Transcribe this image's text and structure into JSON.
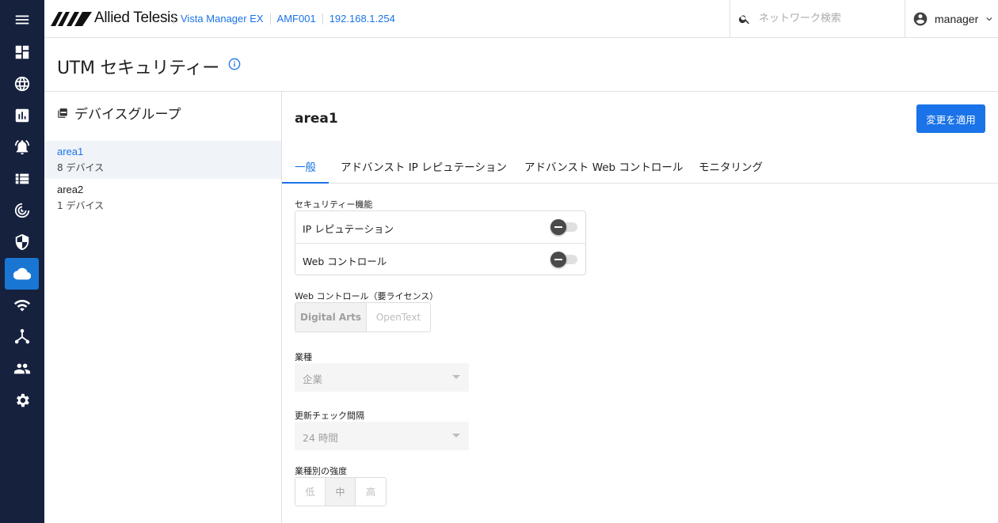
{
  "brand": {
    "logo_text": "Allied Telesis"
  },
  "breadcrumbs": [
    "Vista Manager EX",
    "AMF001",
    "192.168.1.254"
  ],
  "search": {
    "placeholder": "ネットワーク検索"
  },
  "user": {
    "name": "manager"
  },
  "page": {
    "title": "UTM セキュリティー"
  },
  "groups": {
    "heading": "デバイスグループ",
    "items": [
      {
        "name": "area1",
        "count": "8 デバイス"
      },
      {
        "name": "area2",
        "count": "1 デバイス"
      }
    ]
  },
  "detail": {
    "title": "area1",
    "apply_label": "変更を適用",
    "tabs": [
      "一般",
      "アドバンスト IP レピュテーション",
      "アドバンスト Web コントロール",
      "モニタリング"
    ],
    "features_label": "セキュリティー機能",
    "features": [
      {
        "label": "IP レピュテーション",
        "enabled": false
      },
      {
        "label": "Web コントロール",
        "enabled": false
      }
    ],
    "web_control_label": "Web コントロール（要ライセンス）",
    "web_control_options": [
      "Digital Arts",
      "OpenText"
    ],
    "web_control_selected": "Digital Arts",
    "industry_label": "業種",
    "industry_value": "企業",
    "interval_label": "更新チェック間隔",
    "interval_value": "24 時間",
    "strength_label": "業種別の強度",
    "strength_options": [
      "低",
      "中",
      "高"
    ],
    "strength_selected": "中"
  },
  "colors": {
    "rail": "#16213e",
    "accent": "#1a73e8"
  }
}
